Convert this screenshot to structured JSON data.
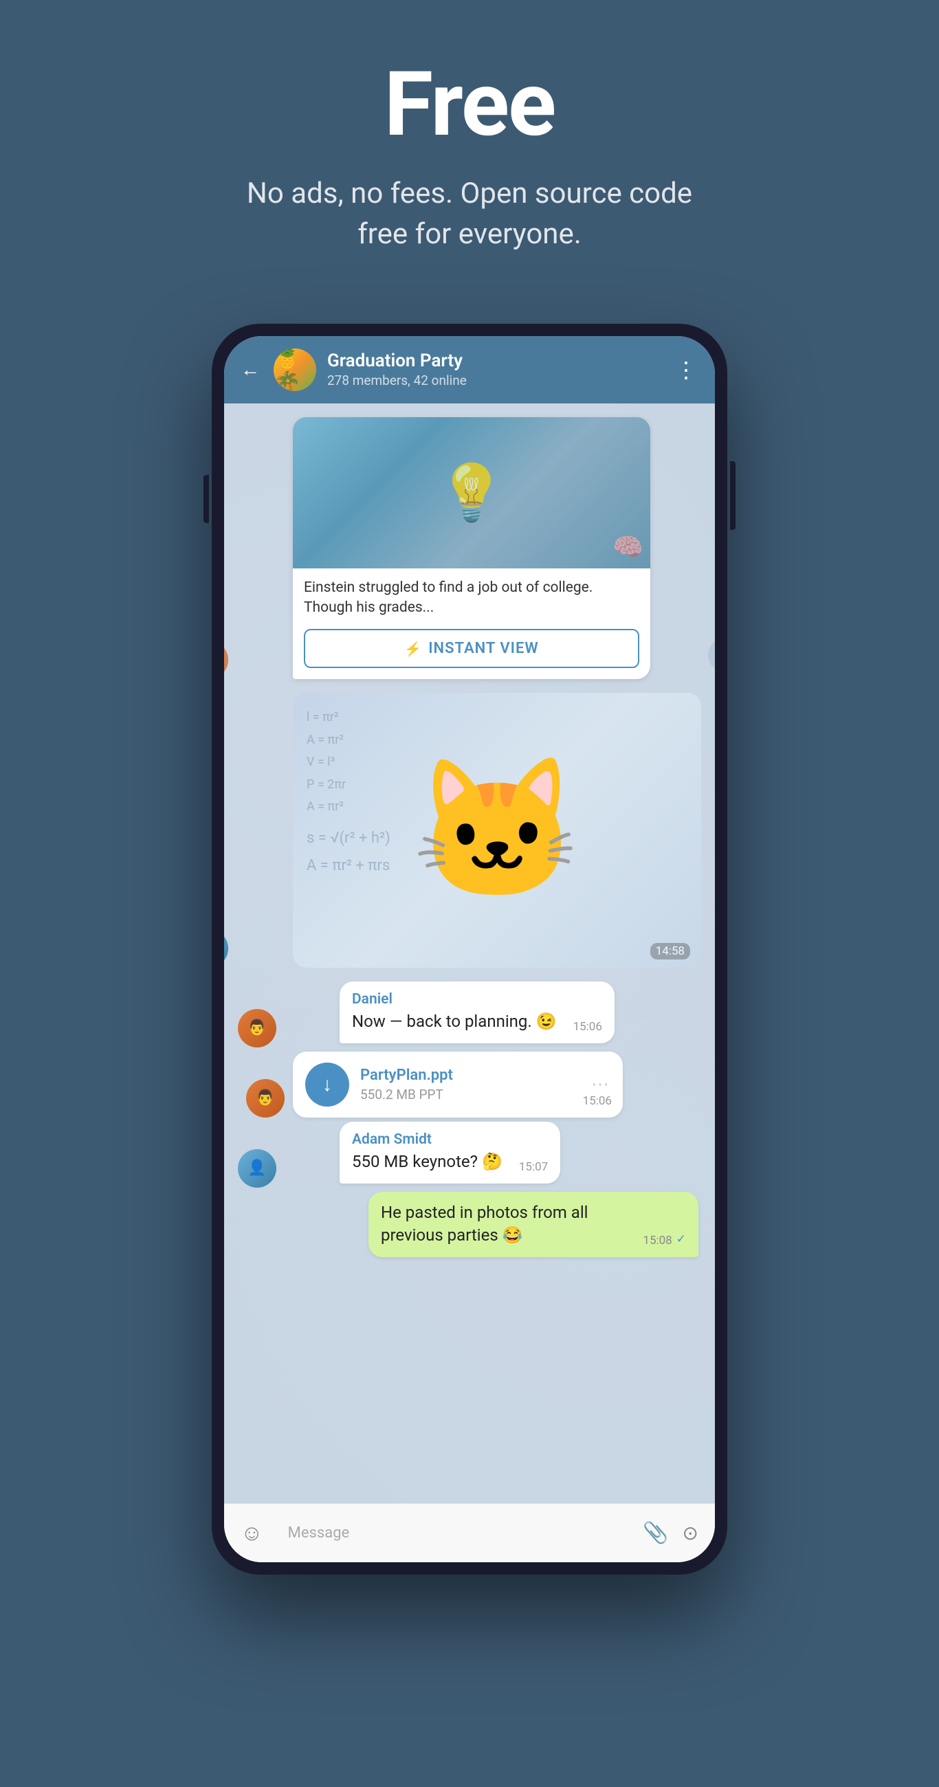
{
  "hero": {
    "title": "Free",
    "subtitle": "No ads, no fees. Open source code free for everyone."
  },
  "chat": {
    "back_label": "←",
    "group_name": "Graduation Party",
    "group_meta": "278 members, 42 online",
    "more_icon": "⋮",
    "avatar_emoji": "🍍"
  },
  "messages": {
    "article_text": "Einstein struggled to find a job out of college. Though his grades...",
    "instant_view_label": "INSTANT VIEW",
    "instant_view_icon": "⚡",
    "sticker_timestamp": "14:58",
    "daniel_name": "Daniel",
    "daniel_text": "Now — back to planning. 😉",
    "daniel_time": "15:06",
    "file_name": "PartyPlan.ppt",
    "file_size": "550.2 MB PPT",
    "file_time": "15:06",
    "adam_name": "Adam Smidt",
    "adam_text": "550 MB keynote? 🤔",
    "adam_time": "15:07",
    "sent_text": "He pasted in photos from all previous parties 😂",
    "sent_time": "15:08",
    "sent_checkmark": "✓"
  },
  "input": {
    "placeholder": "Message",
    "emoji_icon": "☺",
    "attach_icon": "📎",
    "camera_icon": "⊙"
  },
  "colors": {
    "background": "#3d5a73",
    "header": "#4a7a9b",
    "chat_bg": "#c8d5e3",
    "accent": "#4a90c4",
    "sent_bubble": "#d4f4a0",
    "received_bubble": "#ffffff"
  }
}
